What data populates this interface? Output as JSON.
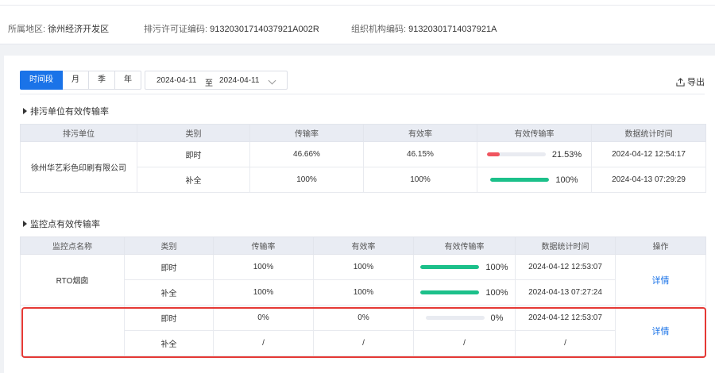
{
  "info": {
    "region_label": "所属地区:",
    "region_value": "徐州经济开发区",
    "permit_label": "排污许可证编码:",
    "permit_value": "91320301714037921A002R",
    "org_label": "组织机构编码:",
    "org_value": "91320301714037921A"
  },
  "toolbar": {
    "periods": [
      "时间段",
      "月",
      "季",
      "年"
    ],
    "active_period": "时间段",
    "date_start": "2024-04-11",
    "date_sep": "至",
    "date_end": "2024-04-11",
    "export_label": "导出"
  },
  "section1": {
    "title": "排污单位有效传输率",
    "columns": [
      "排污单位",
      "类别",
      "传输率",
      "有效率",
      "有效传输率",
      "数据统计时间"
    ],
    "unit_name": "徐州华艺彩色印刷有限公司",
    "rows": [
      {
        "category": "即时",
        "transfer_rate": "46.66%",
        "valid_rate": "46.15%",
        "effective": "21.53%",
        "effective_value": 21.53,
        "bar_color": "#f0555f",
        "time": "2024-04-12 12:54:17"
      },
      {
        "category": "补全",
        "transfer_rate": "100%",
        "valid_rate": "100%",
        "effective": "100%",
        "effective_value": 100,
        "bar_color": "#1cc08a",
        "time": "2024-04-13 07:29:29"
      }
    ]
  },
  "section2": {
    "title": "监控点有效传输率",
    "columns": [
      "监控点名称",
      "类别",
      "传输率",
      "有效率",
      "有效传输率",
      "数据统计时间",
      "操作"
    ],
    "points": [
      {
        "name": "RTO烟囱",
        "action": "详情",
        "rows": [
          {
            "category": "即时",
            "transfer_rate": "100%",
            "valid_rate": "100%",
            "effective": "100%",
            "effective_value": 100,
            "bar_color": "#1cc08a",
            "time": "2024-04-12 12:53:07"
          },
          {
            "category": "补全",
            "transfer_rate": "100%",
            "valid_rate": "100%",
            "effective": "100%",
            "effective_value": 100,
            "bar_color": "#1cc08a",
            "time": "2024-04-13 07:27:24"
          }
        ]
      },
      {
        "name": "",
        "action": "详情",
        "rows": [
          {
            "category": "即时",
            "transfer_rate": "0%",
            "valid_rate": "0%",
            "effective": "0%",
            "effective_value": 0,
            "bar_color": "#1cc08a",
            "time": "2024-04-12 12:53:07"
          },
          {
            "category": "补全",
            "transfer_rate": "/",
            "valid_rate": "/",
            "effective": "/",
            "time": "/"
          }
        ]
      }
    ]
  },
  "colors": {
    "accent": "#1a73e8",
    "highlight_border": "#e53935"
  }
}
